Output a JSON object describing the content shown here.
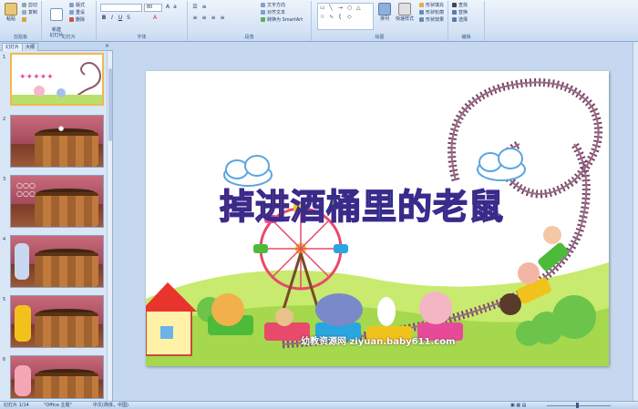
{
  "ribbon": {
    "clipboard": {
      "label": "剪贴板",
      "paste": "粘贴",
      "cut": "剪切",
      "copy": "复制",
      "format_painter": "格式刷"
    },
    "slides": {
      "label": "幻灯片",
      "new_slide": "新建\n幻灯片",
      "layout": "版式",
      "reset": "重设",
      "delete": "删除"
    },
    "font": {
      "label": "字体",
      "font_size": "80"
    },
    "paragraph": {
      "label": "段落",
      "text_direction": "文字方向",
      "align_text": "对齐文本",
      "smartart": "转换为 SmartArt"
    },
    "drawing": {
      "label": "绘图",
      "arrange": "排列",
      "quick_styles": "快速样式",
      "shape_fill": "形状填充",
      "shape_outline": "形状轮廓",
      "shape_effects": "形状效果"
    },
    "editing": {
      "label": "编辑",
      "find": "查找",
      "replace": "替换",
      "select": "选择"
    }
  },
  "panel": {
    "tabs": [
      "幻灯片",
      "大纲"
    ],
    "slide_numbers": [
      "1",
      "2",
      "3",
      "4",
      "5",
      "6"
    ]
  },
  "slide": {
    "title": "掉进酒桶里的老鼠",
    "watermark": "幼教资源网 ziyuan.baby611.com"
  },
  "status": {
    "slide_counter": "幻灯片 1/14",
    "theme": "\"Office 主题\"",
    "language": "中文(简体，中国)"
  },
  "colors": {
    "title_letters": [
      "#e8342c",
      "#f08a1c",
      "#f3c91c",
      "#4dbb3a",
      "#29a6e0",
      "#2f63c9",
      "#8a3fc6",
      "#e84a9a"
    ],
    "ribbon_bg": "#d6e4f5",
    "selected_thumb": "#f2b74a"
  }
}
